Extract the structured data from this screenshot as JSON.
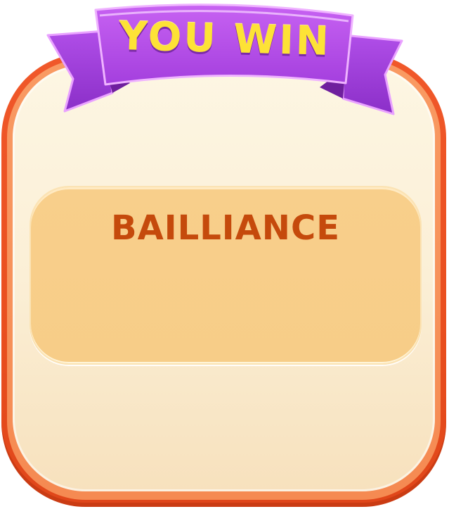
{
  "banner": {
    "title": "YOU WIN"
  },
  "panel": {
    "word": "BAILLIANCE"
  },
  "colors": {
    "frame_orange": "#eb5424",
    "frame_fill": "#fbefd6",
    "panel_fill": "#f8cf8b",
    "word_text": "#c54a0c",
    "ribbon_purple": "#b74ee8",
    "title_yellow": "#fde236"
  }
}
